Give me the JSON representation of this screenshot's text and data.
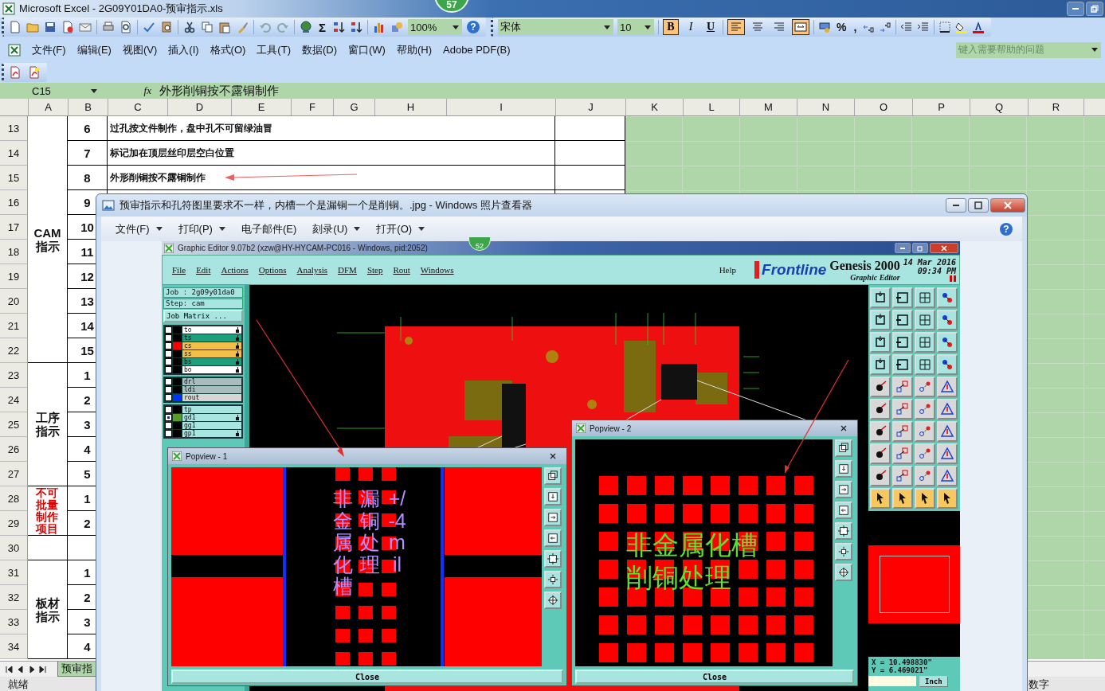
{
  "excel": {
    "title": "Microsoft Excel - 2G09Y01DA0-预审指示.xls",
    "badge": "57",
    "sum_glyph": "Σ",
    "zoom": "100%",
    "help_glyph": "?",
    "font": "宋体",
    "font_size": "10",
    "format_buttons": [
      {
        "kind": "bold",
        "label": "B",
        "on": true
      },
      {
        "kind": "italic",
        "label": "I",
        "on": false
      },
      {
        "kind": "underline",
        "label": "U",
        "on": false
      },
      {
        "kind": "align-left",
        "on": true
      },
      {
        "kind": "align-center",
        "on": false
      },
      {
        "kind": "align-right",
        "on": false
      },
      {
        "kind": "merge",
        "on": true
      }
    ],
    "number_glyphs": [
      "%",
      ","
    ],
    "menu": [
      "文件(F)",
      "编辑(E)",
      "视图(V)",
      "插入(I)",
      "格式(O)",
      "工具(T)",
      "数据(D)",
      "窗口(W)",
      "帮助(H)",
      "Adobe PDF(B)"
    ],
    "help_placeholder": "键入需要帮助的问题",
    "name_box": "C15",
    "fx": "fx",
    "formula": "外形削铜按不露铜制作",
    "columns": [
      "A",
      "B",
      "C",
      "D",
      "E",
      "F",
      "G",
      "H",
      "I",
      "J",
      "K",
      "L",
      "M",
      "N",
      "O",
      "P",
      "Q",
      "R"
    ],
    "sections": [
      {
        "label": "CAM指示",
        "alert": false,
        "rows": [
          {
            "row": "13",
            "no": "6",
            "text": "过孔按文件制作，盘中孔不可留绿油冒"
          },
          {
            "row": "14",
            "no": "7",
            "text": "标记加在顶层丝印层空白位置"
          },
          {
            "row": "15",
            "no": "8",
            "text": "外形削铜按不露铜制作"
          },
          {
            "row": "16",
            "no": "9"
          },
          {
            "row": "17",
            "no": "10"
          },
          {
            "row": "18",
            "no": "11"
          },
          {
            "row": "19",
            "no": "12"
          },
          {
            "row": "20",
            "no": "13"
          },
          {
            "row": "21",
            "no": "14"
          },
          {
            "row": "22",
            "no": "15"
          }
        ]
      },
      {
        "label": "工序指示",
        "alert": false,
        "rows": [
          {
            "row": "23",
            "no": "1"
          },
          {
            "row": "24",
            "no": "2"
          },
          {
            "row": "25",
            "no": "3"
          },
          {
            "row": "26",
            "no": "4"
          },
          {
            "row": "27",
            "no": "5"
          }
        ]
      },
      {
        "label": "不可批量制作项目",
        "alert": true,
        "rows": [
          {
            "row": "28",
            "no": "1"
          },
          {
            "row": "29",
            "no": "2"
          }
        ]
      },
      {
        "rows": [
          {
            "row": "30"
          }
        ]
      },
      {
        "label": "板材指示",
        "alert": false,
        "rows": [
          {
            "row": "31",
            "no": "1"
          },
          {
            "row": "32",
            "no": "2"
          },
          {
            "row": "33",
            "no": "3"
          },
          {
            "row": "34",
            "no": "4"
          }
        ]
      }
    ],
    "sheet_tab": "预审指",
    "status_left": "就绪",
    "status_right": "数字"
  },
  "photo_viewer": {
    "title": "预审指示和孔符图里要求不一样，内槽一个是漏铜一个是削铜。.jpg - Windows 照片查看器",
    "help_glyph": "?",
    "menu": [
      {
        "label": "文件(F)",
        "dropdown": true
      },
      {
        "label": "打印(P)",
        "dropdown": true
      },
      {
        "label": "电子邮件(E)",
        "dropdown": false
      },
      {
        "label": "刻录(U)",
        "dropdown": true
      },
      {
        "label": "打开(O)",
        "dropdown": true
      }
    ]
  },
  "genesis": {
    "title": "Graphic Editor 9.07b2 (xzw@HY-HYCAM-PC016 - Windows, pid:2052)",
    "badge": "52",
    "menu": [
      "File",
      "Edit",
      "Actions",
      "Options",
      "Analysis",
      "DFM",
      "Step",
      "Rout",
      "Windows"
    ],
    "help": "Help",
    "brand": "Frontline",
    "product": "Genesis 2000",
    "subtitle": "Graphic Editor",
    "date": "14 Mar 2016",
    "time": "09:34 PM",
    "job": "Job : 2g09y01da0",
    "step": "Step: cam",
    "matrix_button": "Job Matrix ...",
    "layer_groups": [
      [
        {
          "name": "to",
          "kind": "document",
          "affected": false,
          "hand": true
        },
        {
          "name": "ts",
          "kind": "mask",
          "affected": false,
          "hand": true
        },
        {
          "name": "cs",
          "kind": "silk",
          "color": "#ff0000",
          "affected": false,
          "hand": true
        },
        {
          "name": "ss",
          "kind": "silk",
          "affected": false,
          "hand": true
        },
        {
          "name": "bs",
          "kind": "mask",
          "affected": false,
          "hand": true
        },
        {
          "name": "bo",
          "kind": "document",
          "affected": false,
          "hand": true
        }
      ],
      [
        {
          "name": "drl",
          "kind": "drill",
          "affected": false,
          "hand": false
        },
        {
          "name": "ldi",
          "kind": "drill",
          "affected": false,
          "hand": false
        },
        {
          "name": "rout",
          "kind": "rout",
          "color": "#0033ff",
          "affected": false,
          "hand": false
        }
      ],
      [
        {
          "name": "tp",
          "kind": "misc",
          "affected": false,
          "hand": false
        },
        {
          "name": "gd1",
          "kind": "misc",
          "color": "#5a9e2a",
          "affected": true,
          "hand": true
        },
        {
          "name": "gg1",
          "kind": "misc",
          "affected": false,
          "hand": false
        },
        {
          "name": "gp1",
          "kind": "misc",
          "affected": false,
          "hand": true
        }
      ]
    ],
    "coords": [
      "X = 10.498830\"",
      "Y = 6.469021\""
    ],
    "unit": "Inch",
    "popviews": [
      {
        "title": "Popview - 1",
        "kind": "slot-edge",
        "labels": [
          "非金属化槽",
          "漏铜处理",
          "+/-4mil"
        ],
        "close": "Close"
      },
      {
        "title": "Popview - 2",
        "kind": "pad-grid",
        "labels": [
          "非金属化槽",
          "削铜处理"
        ],
        "close": "Close"
      }
    ]
  }
}
